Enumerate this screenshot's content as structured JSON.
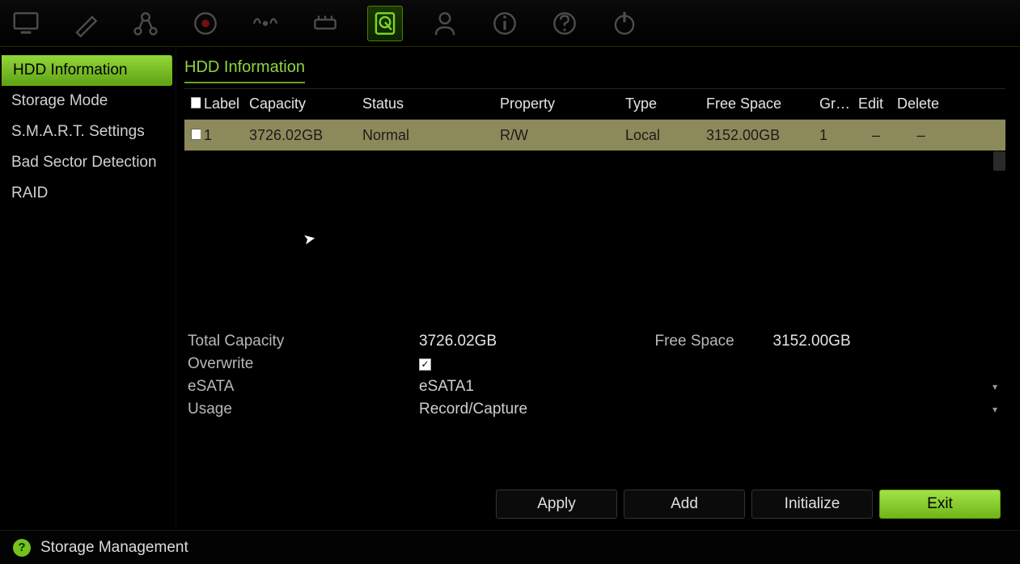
{
  "toolbar_icons": [
    {
      "name": "monitor-icon"
    },
    {
      "name": "pencil-icon"
    },
    {
      "name": "network-icon"
    },
    {
      "name": "record-icon"
    },
    {
      "name": "motion-icon"
    },
    {
      "name": "io-icon"
    },
    {
      "name": "hdd-icon",
      "active": true
    },
    {
      "name": "user-icon"
    },
    {
      "name": "info-icon"
    },
    {
      "name": "help-icon"
    },
    {
      "name": "power-icon"
    }
  ],
  "sidebar": {
    "items": [
      {
        "label": "HDD Information",
        "active": true
      },
      {
        "label": "Storage Mode"
      },
      {
        "label": "S.M.A.R.T. Settings"
      },
      {
        "label": "Bad Sector Detection"
      },
      {
        "label": "RAID"
      }
    ]
  },
  "page_title": "HDD Information",
  "table": {
    "headers": {
      "label": "Label",
      "capacity": "Capacity",
      "status": "Status",
      "property": "Property",
      "type": "Type",
      "free_space": "Free Space",
      "group": "Gro...",
      "edit": "Edit",
      "delete": "Delete"
    },
    "rows": [
      {
        "label": "1",
        "capacity": "3726.02GB",
        "status": "Normal",
        "property": "R/W",
        "type": "Local",
        "free_space": "3152.00GB",
        "group": "1",
        "edit": "–",
        "delete": "–"
      }
    ]
  },
  "summary": {
    "total_capacity_label": "Total Capacity",
    "total_capacity": "3726.02GB",
    "free_space_label": "Free Space",
    "free_space": "3152.00GB",
    "overwrite_label": "Overwrite",
    "overwrite_checked": "✓",
    "esata_label": "eSATA",
    "esata_value": "eSATA1",
    "usage_label": "Usage",
    "usage_value": "Record/Capture"
  },
  "buttons": {
    "apply": "Apply",
    "add": "Add",
    "initialize": "Initialize",
    "exit": "Exit"
  },
  "footer": {
    "title": "Storage Management",
    "hint": "?"
  }
}
